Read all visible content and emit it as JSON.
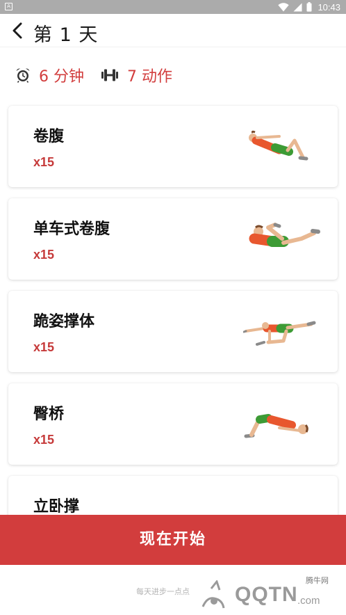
{
  "status_bar": {
    "time": "10:43",
    "notification_icon": "A"
  },
  "header": {
    "title": "第 1 天"
  },
  "summary": {
    "duration": "6 分钟",
    "exercise_count": "7 动作"
  },
  "exercises": [
    {
      "name": "卷腹",
      "reps": "x15",
      "illustration": "crunch-illustration"
    },
    {
      "name": "单车式卷腹",
      "reps": "x15",
      "illustration": "bicycle-crunch-illustration"
    },
    {
      "name": "跪姿撑体",
      "reps": "x15",
      "illustration": "bird-dog-illustration"
    },
    {
      "name": "臀桥",
      "reps": "x15",
      "illustration": "glute-bridge-illustration"
    },
    {
      "name": "立卧撑",
      "reps": "",
      "illustration": ""
    }
  ],
  "start_button": {
    "label": "现在开始"
  },
  "footer": {
    "slogan": "每天进步一点点",
    "watermark_site": "腾牛网",
    "watermark_text": "QQTN",
    "watermark_suffix": ".com"
  },
  "colors": {
    "accent": "#d23d3d",
    "status_bar": "#ababab",
    "shirt": "#e8572e",
    "shorts": "#3d9b35",
    "skin": "#e8b892"
  }
}
